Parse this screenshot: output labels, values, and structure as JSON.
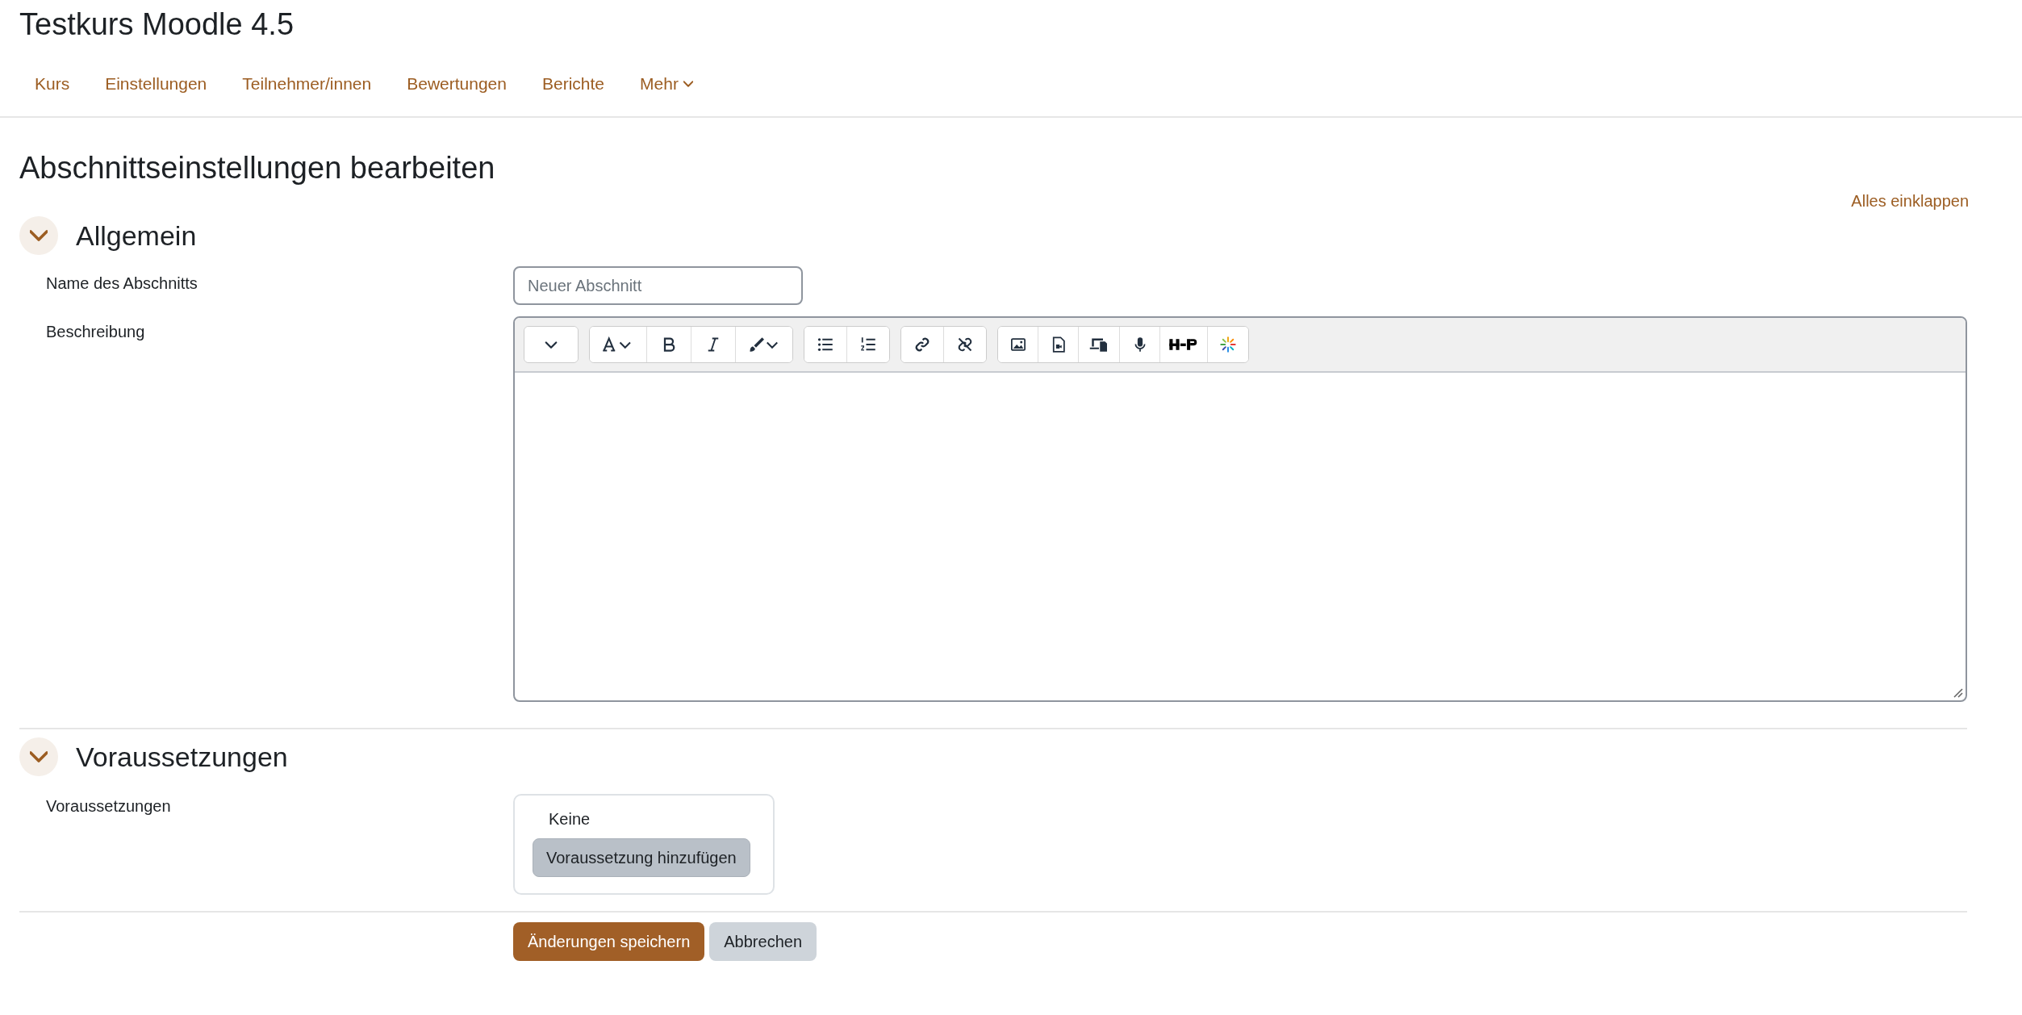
{
  "course_title": "Testkurs Moodle 4.5",
  "nav": [
    {
      "label": "Kurs",
      "kind": "link"
    },
    {
      "label": "Einstellungen",
      "kind": "link"
    },
    {
      "label": "Teilnehmer/innen",
      "kind": "link"
    },
    {
      "label": "Bewertungen",
      "kind": "link"
    },
    {
      "label": "Berichte",
      "kind": "link"
    },
    {
      "label": "Mehr",
      "kind": "dropdown"
    }
  ],
  "page_title": "Abschnittseinstellungen bearbeiten",
  "collapse_all": "Alles einklappen",
  "sections": [
    {
      "title": "Allgemein",
      "expanded": true,
      "fields": [
        {
          "kind": "text",
          "label": "Name des Abschnitts",
          "placeholder": "Neuer Abschnitt"
        },
        {
          "kind": "editor",
          "label": "Beschreibung"
        }
      ]
    },
    {
      "title": "Voraussetzungen",
      "expanded": true,
      "fields": [
        {
          "kind": "restrictions",
          "label": "Voraussetzungen",
          "summary": "Keine",
          "button": "Voraussetzung hinzufügen"
        }
      ]
    }
  ],
  "buttons": [
    {
      "label": "Änderungen speichern",
      "kind": "primary"
    },
    {
      "label": "Abbrechen",
      "kind": "secondary"
    }
  ]
}
